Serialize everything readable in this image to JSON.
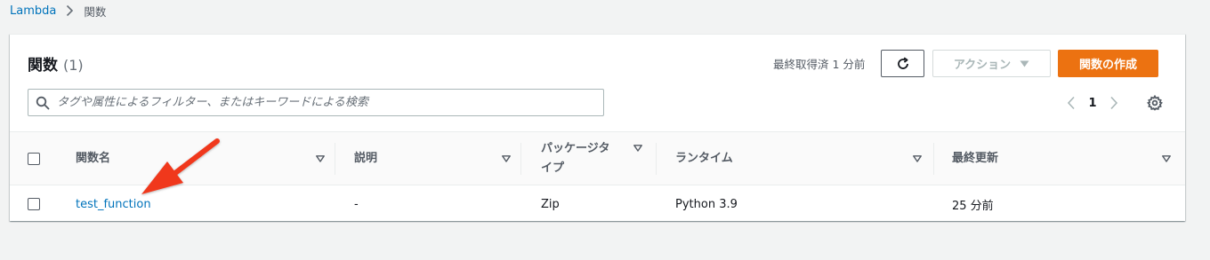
{
  "breadcrumb": {
    "root": "Lambda",
    "current": "関数"
  },
  "panel": {
    "title": "関数",
    "count": "(1)",
    "last_fetched": "最終取得済 1 分前",
    "action_label": "アクション",
    "create_label": "関数の作成",
    "search_placeholder": "タグや属性によるフィルター、またはキーワードによる検索",
    "search_value": "",
    "page_number": "1"
  },
  "table": {
    "columns": [
      "関数名",
      "説明",
      "パッケージタイプ",
      "ランタイム",
      "最終更新"
    ],
    "rows": [
      {
        "name": "test_function",
        "description": "-",
        "package_type": "Zip",
        "runtime": "Python 3.9",
        "last_modified": "25 分前"
      }
    ]
  },
  "colors": {
    "link": "#0073bb",
    "primary_button": "#ec7211",
    "annotation_arrow": "#f0391f"
  }
}
